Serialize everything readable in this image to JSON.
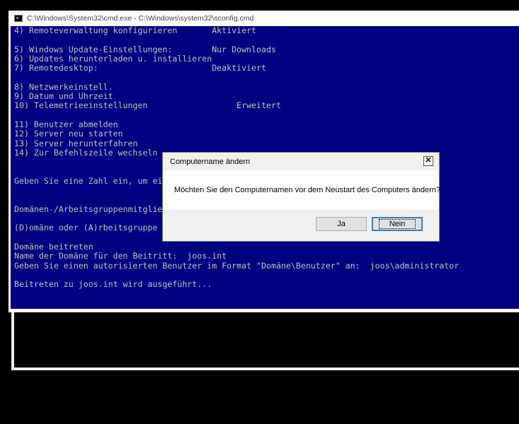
{
  "window": {
    "title": "C:\\Windows\\System32\\cmd.exe - C:\\Windows\\system32\\sconfig.cmd"
  },
  "console": {
    "lines": [
      "4) Remoteverwaltung konfigurieren       Aktiviert",
      "",
      "5) Windows Update-Einstellungen:        Nur Downloads",
      "6) Updates herunterladen u. installieren",
      "7) Remotedesktop:                       Deaktiviert",
      "",
      "8) Netzwerkeinstell.",
      "9) Datum und Uhrzeit",
      "10) Telemetrieeinstellungen                  Erweitert",
      "",
      "11) Benutzer abmelden",
      "12) Server neu starten",
      "13) Server herunterfahren",
      "14) Zur Befehlszeile wechseln",
      "",
      "",
      "Geben Sie eine Zahl ein, um eine",
      "",
      "",
      "Domänen-/Arbeitsgruppenmitglieds",
      "",
      "(D)omäne oder (A)rbeitsgruppe be",
      "",
      "Domäne beitreten",
      "Name der Domäne für den Beitritt:  joos.int",
      "Geben Sie einen autorisierten Benutzer im Format \"Domäne\\Benutzer\" an:  joos\\administrator",
      "",
      "Beitreten zu joos.int wird ausgeführt..."
    ]
  },
  "dialog": {
    "title": "Computername ändern",
    "close_symbol": "✕",
    "message": "Möchten Sie den Computernamen vor dem Neustart des Computers ändern?",
    "yes_label": "Ja",
    "no_label": "Nein"
  },
  "colors": {
    "console_background": "#000080",
    "console_text": "#c0c0c0"
  }
}
